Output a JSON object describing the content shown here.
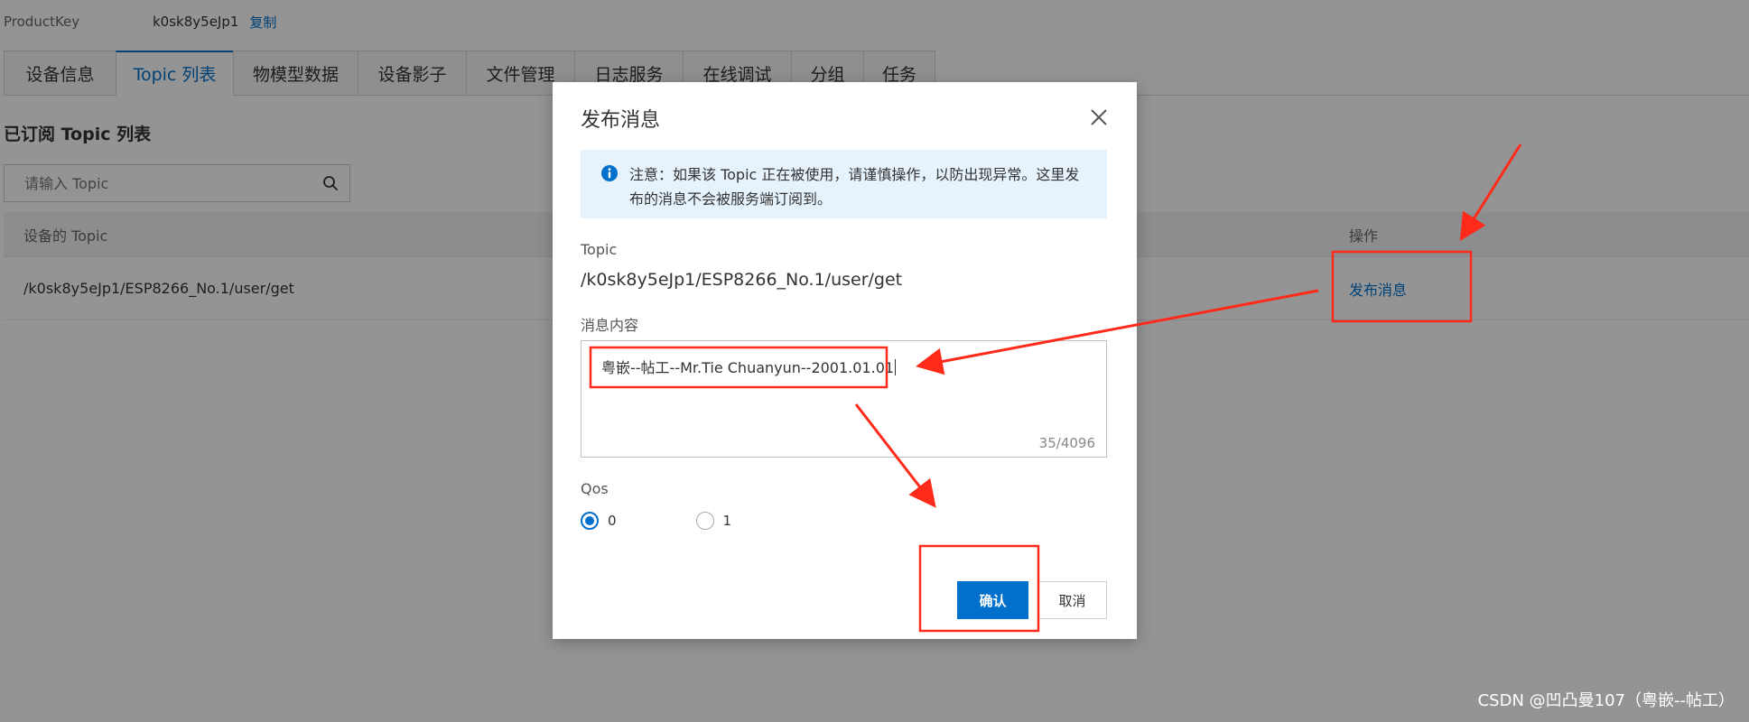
{
  "product_key": {
    "label": "ProductKey",
    "value": "k0sk8y5eJp1",
    "copy_label": "复制"
  },
  "tabs": [
    {
      "label": "设备信息"
    },
    {
      "label": "Topic 列表",
      "active": true
    },
    {
      "label": "物模型数据"
    },
    {
      "label": "设备影子"
    },
    {
      "label": "文件管理"
    },
    {
      "label": "日志服务"
    },
    {
      "label": "在线调试"
    },
    {
      "label": "分组"
    },
    {
      "label": "任务"
    }
  ],
  "section_title": "已订阅 Topic 列表",
  "search": {
    "placeholder": "请输入 Topic"
  },
  "table": {
    "headers": [
      "设备的 Topic",
      "操作"
    ],
    "rows": [
      {
        "topic": "/k0sk8y5eJp1/ESP8266_No.1/user/get",
        "action": "发布消息"
      }
    ]
  },
  "dialog": {
    "title": "发布消息",
    "notice_line1": "注意：如果该 Topic 正在被使用，请谨慎操作，以防出现异常。这里发",
    "notice_line2": "布的消息不会被服务端订阅到。",
    "topic_label": "Topic",
    "topic_value": "/k0sk8y5eJp1/ESP8266_No.1/user/get",
    "content_label": "消息内容",
    "content_value": "粤嵌--帖工--Mr.Tie Chuanyun--2001.01.01",
    "counter": "35/4096",
    "qos_label": "Qos",
    "qos_options": [
      "0",
      "1"
    ],
    "qos_selected": "0",
    "confirm_label": "确认",
    "cancel_label": "取消"
  },
  "watermark": "CSDN @凹凸曼107（粤嵌--帖工）",
  "colors": {
    "primary": "#0070cc",
    "annotation": "#ff2a1a",
    "notice_bg": "#e6f3fd"
  }
}
